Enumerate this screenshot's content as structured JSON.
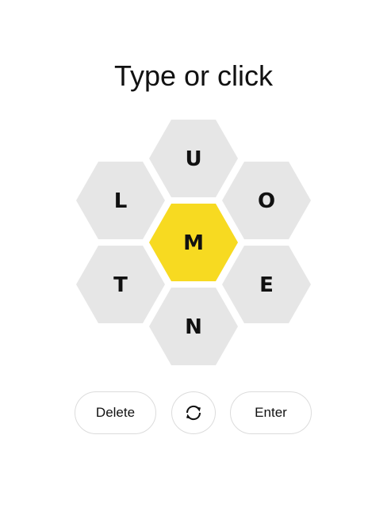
{
  "prompt": "Type or click",
  "hive": {
    "center_letter": "M",
    "outer_letters": [
      "U",
      "O",
      "E",
      "N",
      "T",
      "L"
    ],
    "colors": {
      "center": "#f7da21",
      "outer": "#e6e6e6",
      "letter": "#111111"
    }
  },
  "controls": {
    "delete_label": "Delete",
    "shuffle_icon": "shuffle-icon",
    "enter_label": "Enter"
  }
}
